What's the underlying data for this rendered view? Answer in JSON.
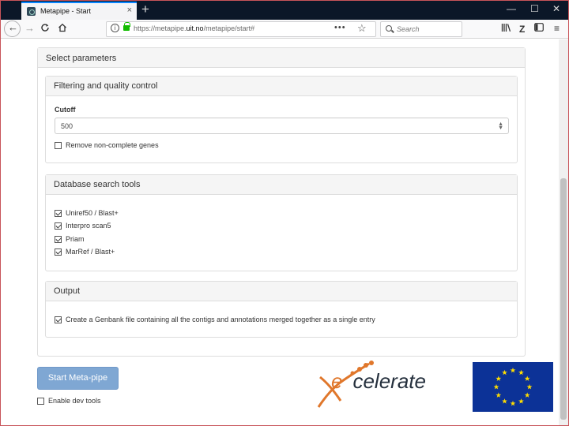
{
  "browser": {
    "tab_title": "Metapipe - Start",
    "tab_close": "×",
    "new_tab": "+",
    "window_controls": {
      "minimize": "—",
      "restore": "☐",
      "close": "✕"
    },
    "url_prefix": "https://metapipe.",
    "url_domain": "uit.no",
    "url_suffix": "/metapipe/start#",
    "url_more": "•••",
    "search_placeholder": "Search"
  },
  "form": {
    "section_title": "Select parameters",
    "filtering": {
      "title": "Filtering and quality control",
      "cutoff_label": "Cutoff",
      "cutoff_value": "500",
      "remove_incomplete": {
        "label": "Remove non-complete genes",
        "checked": false
      }
    },
    "database": {
      "title": "Database search tools",
      "tools": [
        {
          "label": "Uniref50 / Blast+",
          "checked": true
        },
        {
          "label": "Interpro scan5",
          "checked": true
        },
        {
          "label": "Priam",
          "checked": true
        },
        {
          "label": "MarRef / Blast+",
          "checked": true
        }
      ]
    },
    "output": {
      "title": "Output",
      "genbank": {
        "label": "Create a Genbank file containing all the contigs and annotations merged together as a single entry",
        "checked": true
      }
    },
    "start_button": "Start Meta-pipe",
    "dev_tools": {
      "label": "Enable dev tools",
      "checked": false
    }
  },
  "logos": {
    "excelerate_e": "e",
    "excelerate_x": "x",
    "excelerate_rest": "celerate"
  },
  "colors": {
    "accent_button": "#7fa7d3",
    "eu_blue": "#0c3297",
    "eu_star": "#ffdd00",
    "logo_orange": "#e0772b"
  }
}
